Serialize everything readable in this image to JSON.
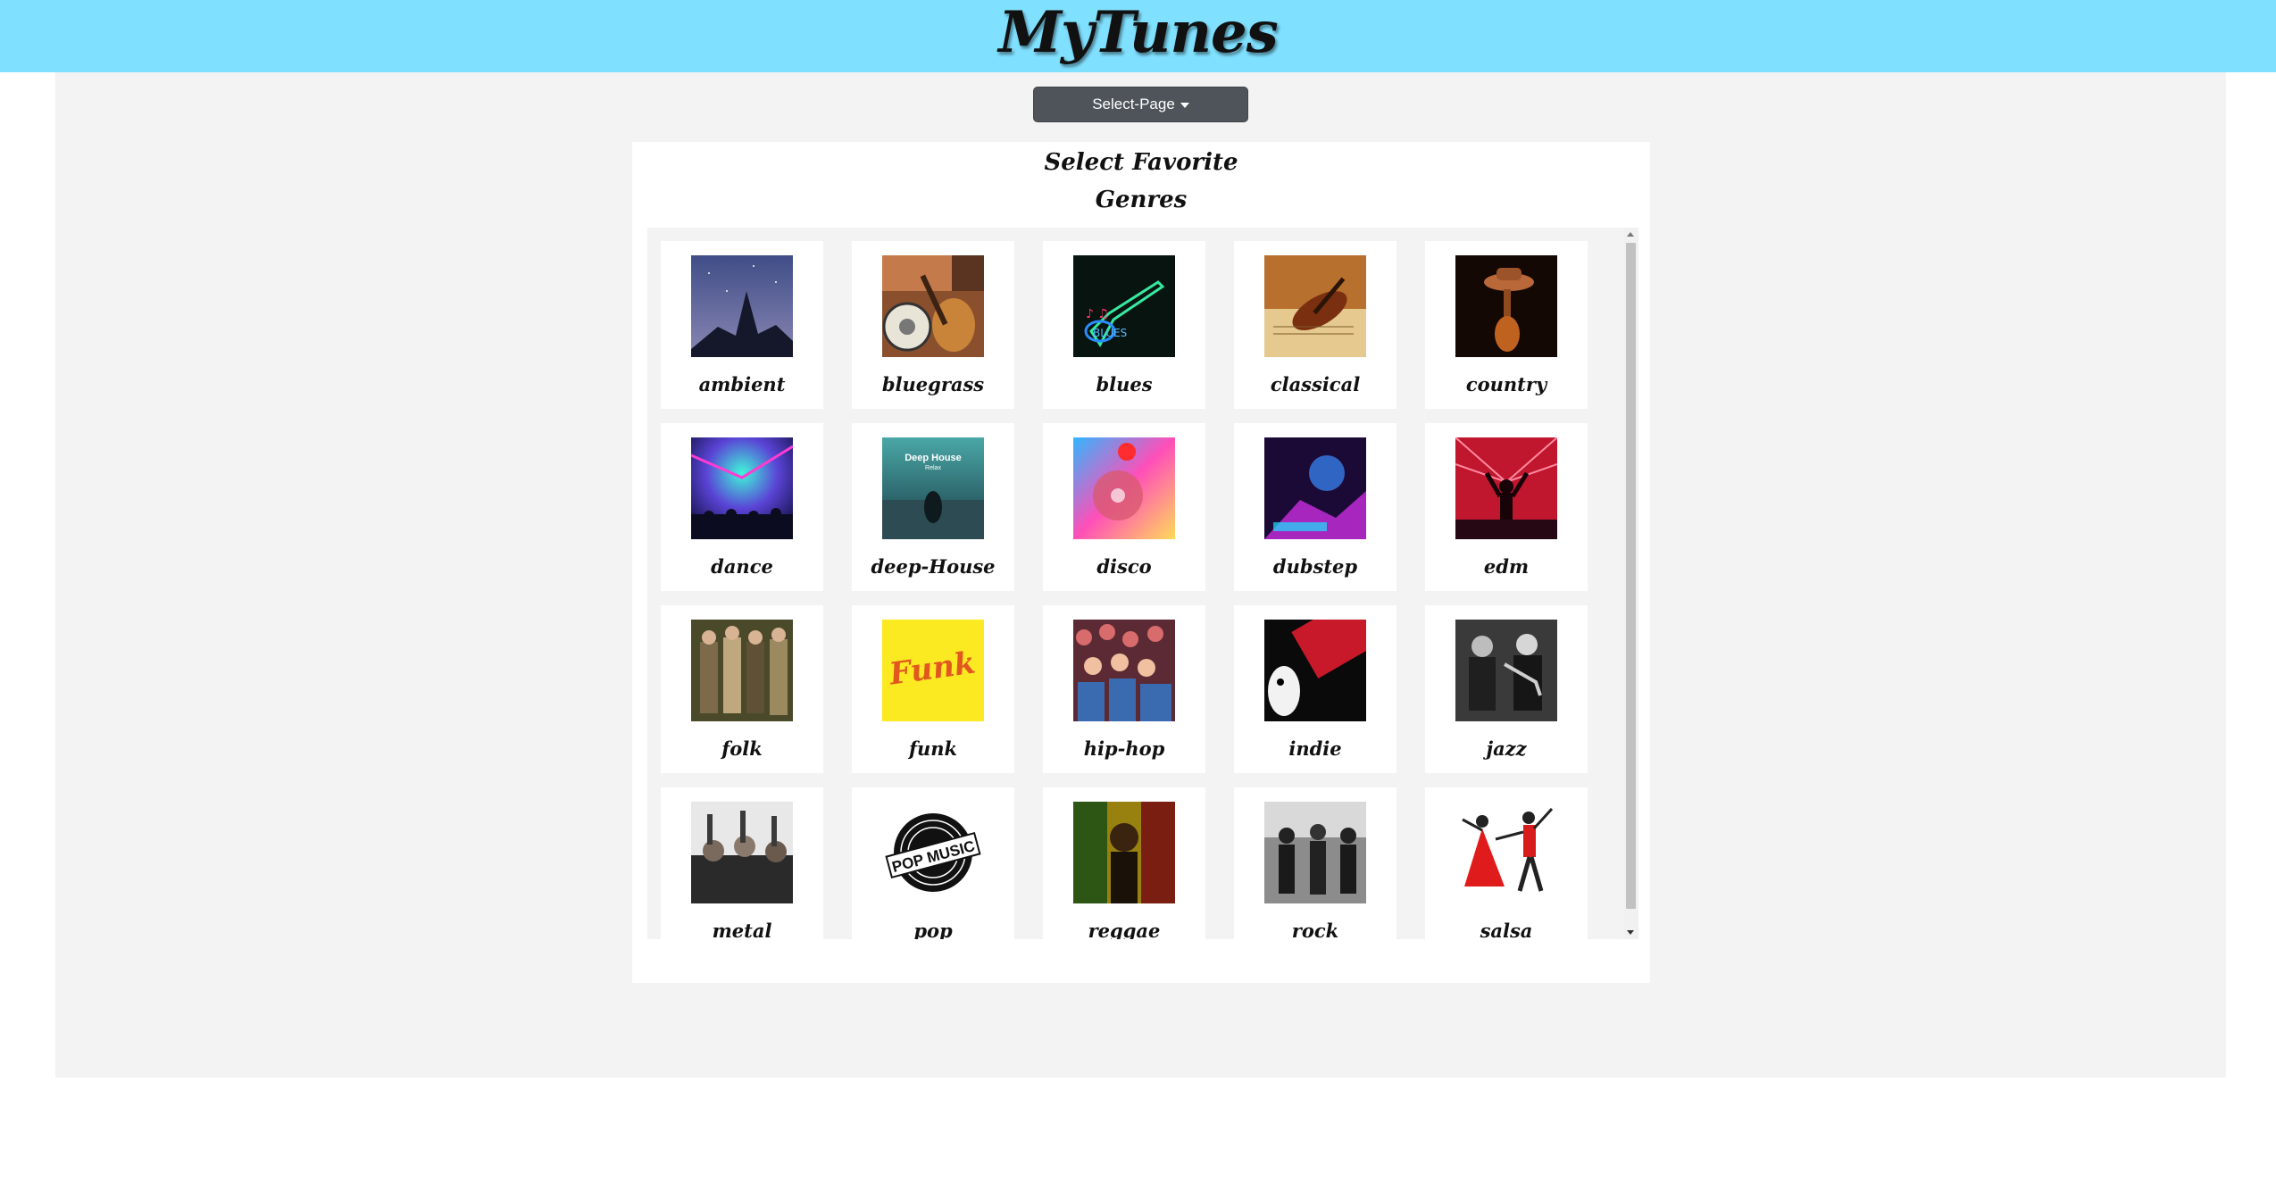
{
  "app": {
    "title": "MyTunes"
  },
  "nav": {
    "select_page_label": "Select-Page"
  },
  "panel": {
    "title_line1": "Select Favorite",
    "title_line2": "Genres"
  },
  "genres": [
    {
      "label": "ambient",
      "icon": "ambient-image"
    },
    {
      "label": "bluegrass",
      "icon": "bluegrass-image"
    },
    {
      "label": "blues",
      "icon": "blues-image"
    },
    {
      "label": "classical",
      "icon": "classical-image"
    },
    {
      "label": "country",
      "icon": "country-image"
    },
    {
      "label": "dance",
      "icon": "dance-image"
    },
    {
      "label": "deep-House",
      "icon": "deep-house-image",
      "image_text": "Deep House",
      "image_subtext": "Relax"
    },
    {
      "label": "disco",
      "icon": "disco-image"
    },
    {
      "label": "dubstep",
      "icon": "dubstep-image"
    },
    {
      "label": "edm",
      "icon": "edm-image"
    },
    {
      "label": "folk",
      "icon": "folk-image"
    },
    {
      "label": "funk",
      "icon": "funk-image",
      "image_text": "Funk"
    },
    {
      "label": "hip-hop",
      "icon": "hip-hop-image"
    },
    {
      "label": "indie",
      "icon": "indie-image"
    },
    {
      "label": "jazz",
      "icon": "jazz-image"
    },
    {
      "label": "metal",
      "icon": "metal-image"
    },
    {
      "label": "pop",
      "icon": "pop-image",
      "image_text": "POP MUSIC"
    },
    {
      "label": "reggae",
      "icon": "reggae-image"
    },
    {
      "label": "rock",
      "icon": "rock-image"
    },
    {
      "label": "salsa",
      "icon": "salsa-image"
    }
  ],
  "colors": {
    "header_bg": "#80e0ff",
    "panel_bg": "#f3f3f3",
    "button_bg": "#4e545a"
  }
}
